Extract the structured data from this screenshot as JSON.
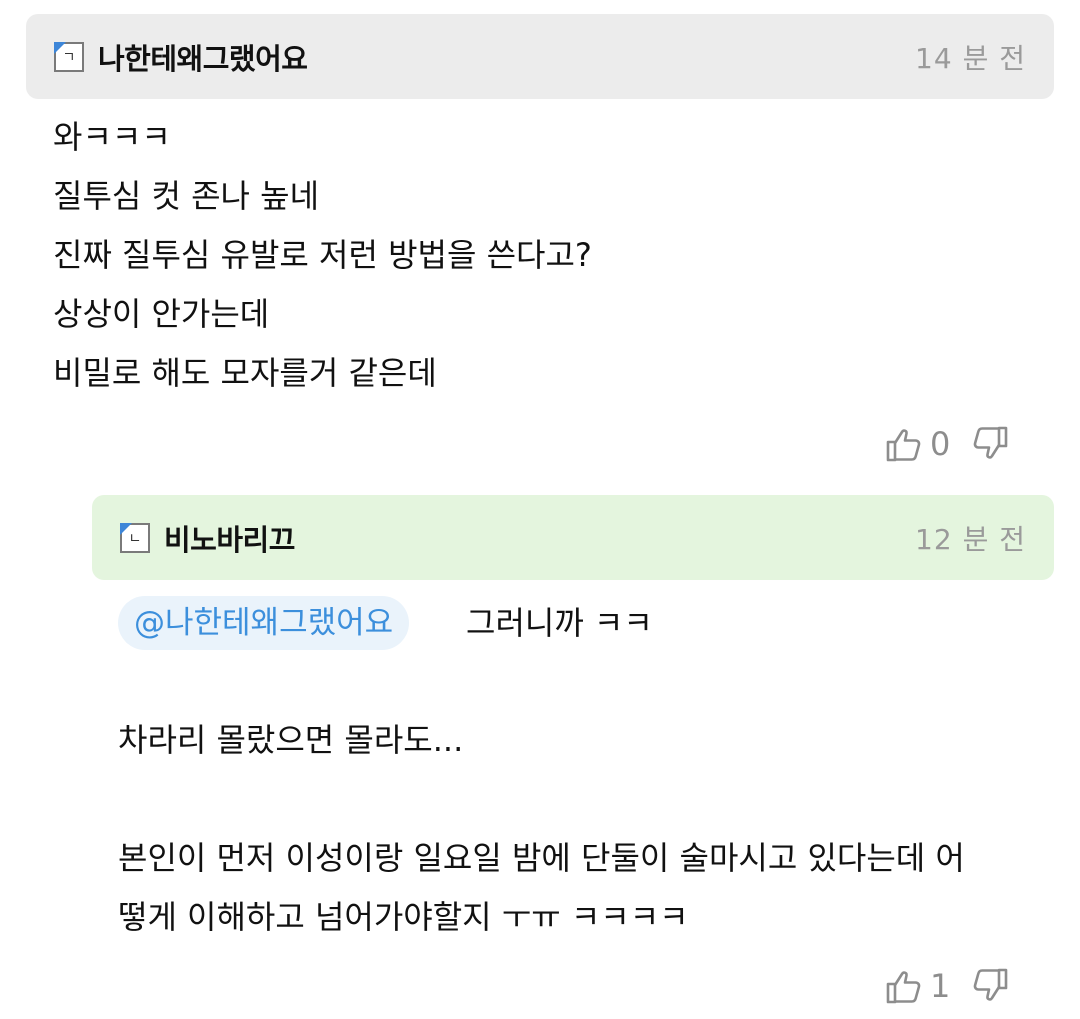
{
  "comment1": {
    "level": "ㄱ",
    "username": "나한테왜그랬어요",
    "timestamp": "14 분 전",
    "lines": [
      "와ㅋㅋㅋ",
      "질투심 컷 존나 높네",
      "진짜 질투심 유발로 저런 방법을 쓴다고?",
      "상상이 안가는데",
      "비밀로 해도 모자를거 같은데"
    ],
    "like_count": "0"
  },
  "comment2": {
    "level": "ㄴ",
    "username": "비노바리끄",
    "timestamp": "12 분 전",
    "mention": "@나한테왜그랬어요",
    "first_line": "그러니까 ㅋㅋ",
    "line2": "차라리 몰랐으면 몰라도...",
    "line3": "본인이 먼저 이성이랑 일요일 밤에 단둘이 술마시고 있다는데 어",
    "line4": "떻게 이해하고 넘어가야할지 ㅜㅠ ㅋㅋㅋㅋ",
    "like_count": "1"
  }
}
